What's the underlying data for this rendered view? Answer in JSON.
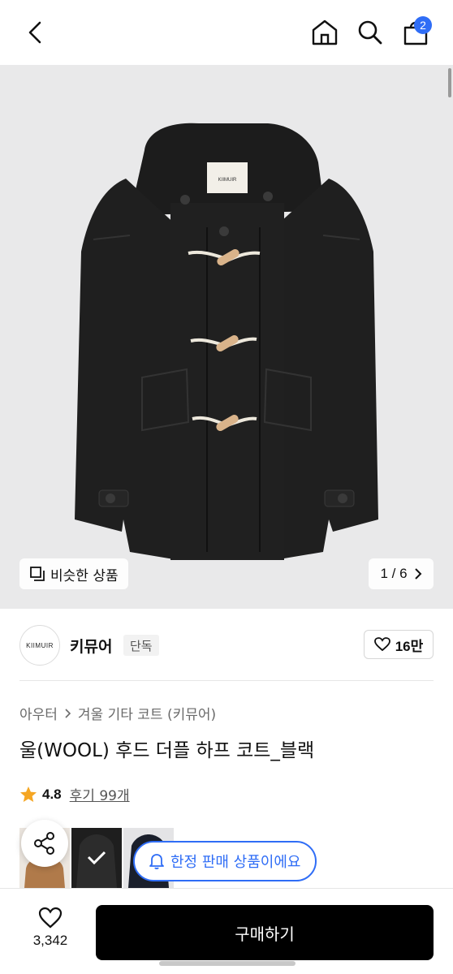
{
  "header": {
    "back_icon": "chevron-left-icon",
    "home_icon": "home-icon",
    "search_icon": "search-icon",
    "cart_icon": "shopping-bag-icon",
    "cart_badge": "2",
    "badge_color": "#2f6df6"
  },
  "gallery": {
    "similar_label": "비슷한 상품",
    "page_indicator": "1 / 6",
    "background": "#e9e9ea"
  },
  "brand": {
    "logo_text": "KIIMUIR",
    "name": "키뮤어",
    "exclusive_label": "단독",
    "likes": "16만"
  },
  "product": {
    "breadcrumb_parent": "아우터",
    "breadcrumb_child": "겨울 기타 코트 (키뮤어)",
    "title": "울(WOOL) 후드 더플 하프 코트_블랙",
    "rating": "4.8",
    "reviews": "후기 99개",
    "star_color": "#f5a623"
  },
  "promo": {
    "limited_label": "한정 판매 상품이에요",
    "accent": "#2f6df6"
  },
  "bottom": {
    "wish_count": "3,342",
    "buy_label": "구매하기"
  }
}
